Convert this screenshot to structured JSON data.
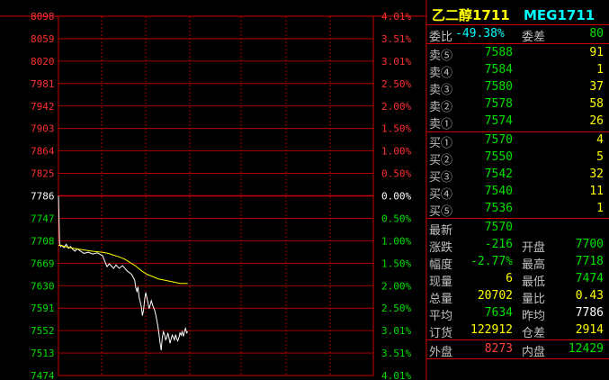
{
  "header": {
    "name_cn": "乙二醇1711",
    "code": "MEG1711"
  },
  "weibi": {
    "label": "委比",
    "value": "-49.38%",
    "diff_label": "委差",
    "diff_value": "80"
  },
  "sells": [
    {
      "label": "卖⑤",
      "price": "7588",
      "vol": "91"
    },
    {
      "label": "卖④",
      "price": "7584",
      "vol": "1"
    },
    {
      "label": "卖③",
      "price": "7580",
      "vol": "37"
    },
    {
      "label": "卖②",
      "price": "7578",
      "vol": "58"
    },
    {
      "label": "卖①",
      "price": "7574",
      "vol": "26"
    }
  ],
  "buys": [
    {
      "label": "买①",
      "price": "7570",
      "vol": "4"
    },
    {
      "label": "买②",
      "price": "7550",
      "vol": "5"
    },
    {
      "label": "买③",
      "price": "7542",
      "vol": "32"
    },
    {
      "label": "买④",
      "price": "7540",
      "vol": "11"
    },
    {
      "label": "买⑤",
      "price": "7536",
      "vol": "1"
    }
  ],
  "stats": {
    "latest_label": "最新",
    "latest": "7570",
    "change_label": "涨跌",
    "change": "-216",
    "open_label": "开盘",
    "open": "7700",
    "pct_label": "幅度",
    "pct": "-2.77%",
    "high_label": "最高",
    "high": "7718",
    "cur_vol_label": "现量",
    "cur_vol": "6",
    "low_label": "最低",
    "low": "7474",
    "total_vol_label": "总量",
    "total_vol": "20702",
    "vol_ratio_label": "量比",
    "vol_ratio": "0.43",
    "avg_label": "平均",
    "avg": "7634",
    "prev_close_label": "昨均",
    "prev_close": "7786",
    "oi_label": "订货",
    "oi": "122912",
    "oi_diff_label": "仓差",
    "oi_diff": "2914",
    "outer_label": "外盘",
    "outer": "8273",
    "inner_label": "内盘",
    "inner": "12429"
  },
  "chart_data": {
    "type": "line",
    "base_price": 7786,
    "ylim": [
      7474,
      8098
    ],
    "price_ticks": [
      8098,
      8059,
      8020,
      7981,
      7942,
      7903,
      7864,
      7825,
      7786,
      7747,
      7708,
      7669,
      7630,
      7591,
      7552,
      7513,
      7474
    ],
    "pct_ticks": [
      "4.01%",
      "3.51%",
      "3.01%",
      "2.50%",
      "2.00%",
      "1.50%",
      "1.00%",
      "0.50%",
      "0.00%",
      "0.50%",
      "1.00%",
      "1.50%",
      "2.00%",
      "2.50%",
      "3.01%",
      "3.51%",
      "4.01%"
    ],
    "series": [
      {
        "x": [
          0,
          1,
          2,
          3,
          5,
          7,
          9,
          11,
          13,
          15,
          17,
          20,
          23,
          27,
          31,
          35,
          38,
          40,
          42,
          44,
          46,
          48,
          50,
          52,
          55,
          58,
          62,
          66,
          69,
          70,
          71,
          72,
          73,
          74,
          75,
          76,
          77,
          78,
          79,
          80,
          81,
          82,
          83,
          84,
          85,
          86,
          87,
          88,
          89,
          90,
          91,
          92,
          93,
          94,
          95,
          96,
          97,
          98,
          99,
          100,
          101,
          102,
          103,
          104,
          105,
          106,
          107,
          108,
          109,
          110,
          111,
          112,
          113,
          114,
          115,
          116,
          117
        ],
        "values": [
          7786,
          7704,
          7698,
          7700,
          7696,
          7702,
          7695,
          7698,
          7693,
          7690,
          7694,
          7690,
          7686,
          7688,
          7685,
          7687,
          7684,
          7682,
          7672,
          7663,
          7668,
          7664,
          7660,
          7666,
          7660,
          7665,
          7656,
          7650,
          7640,
          7626,
          7620,
          7628,
          7610,
          7602,
          7594,
          7578,
          7588,
          7606,
          7618,
          7610,
          7600,
          7590,
          7596,
          7604,
          7598,
          7592,
          7588,
          7580,
          7570,
          7560,
          7545,
          7530,
          7518,
          7540,
          7550,
          7545,
          7536,
          7540,
          7548,
          7540,
          7530,
          7538,
          7544,
          7540,
          7536,
          7545,
          7538,
          7534,
          7540,
          7548,
          7544,
          7550,
          7542,
          7550,
          7556,
          7548,
          7550
        ]
      },
      {
        "x": [
          0,
          2,
          10,
          20,
          30,
          40,
          45,
          50,
          55,
          60,
          65,
          70,
          75,
          80,
          85,
          90,
          95,
          100,
          105,
          110,
          117
        ],
        "values": [
          7700,
          7700,
          7696,
          7693,
          7690,
          7688,
          7686,
          7683,
          7680,
          7676,
          7670,
          7664,
          7656,
          7650,
          7646,
          7642,
          7640,
          7638,
          7636,
          7634,
          7634
        ]
      }
    ]
  }
}
